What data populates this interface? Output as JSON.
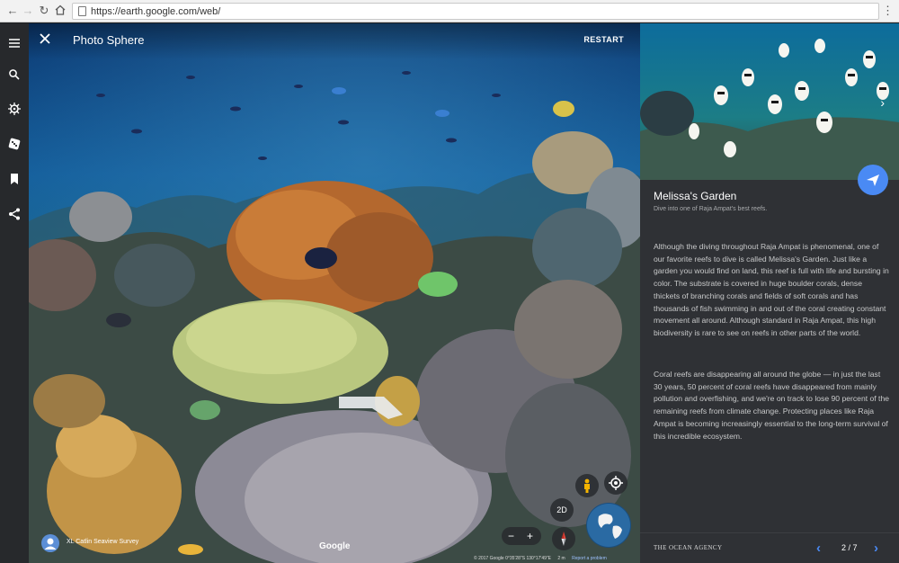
{
  "browser": {
    "url": "https://earth.google.com/web/",
    "back_icon": "arrow-back",
    "forward_icon": "arrow-forward",
    "reload_icon": "reload",
    "home_icon": "home",
    "menu_icon": "kebab-menu"
  },
  "rail": {
    "items": [
      {
        "icon": "hamburger-menu"
      },
      {
        "icon": "search"
      },
      {
        "icon": "voyager-wheel"
      },
      {
        "icon": "dice"
      },
      {
        "icon": "bookmark"
      },
      {
        "icon": "share"
      }
    ]
  },
  "viewer": {
    "title": "Photo Sphere",
    "restart_label": "RESTART",
    "attribution": "XL Catlin Seaview Survey",
    "google_logo": "Google",
    "copyright": "© 2017 Google",
    "coordinates": "0°35'28\"S 130°17'49\"E",
    "scale": "2 m",
    "report_label": "Report a problem",
    "twod_label": "2D",
    "zoom_out_label": "−",
    "zoom_in_label": "+"
  },
  "story": {
    "title": "Melissa's Garden",
    "subtitle": "Dive into one of Raja Ampat's best reefs.",
    "paragraphs": [
      "Although the diving throughout Raja Ampat is phenomenal, one of our favorite reefs to dive is called Melissa's Garden. Just like a garden you would find on land, this reef is full with life and bursting in color. The substrate is covered in huge boulder corals, dense thickets of branching corals and fields of soft corals and has thousands of fish swimming in and out of the coral creating constant movement all around. Although standard in Raja Ampat, this high biodiversity is rare to see on reefs in other parts of the world.",
      "Coral reefs are disappearing all around the globe — in just the last 30 years, 50 percent of coral reefs have disappeared from mainly pollution and overfishing, and we're on track to lose 90 percent of the remaining reefs from climate change. Protecting places like Raja Ampat is becoming increasingly essential to the long-term survival of this incredible ecosystem."
    ],
    "brand": "THE OCEAN AGENCY",
    "page_indicator": "2 / 7",
    "accent_color": "#4a8af4"
  }
}
